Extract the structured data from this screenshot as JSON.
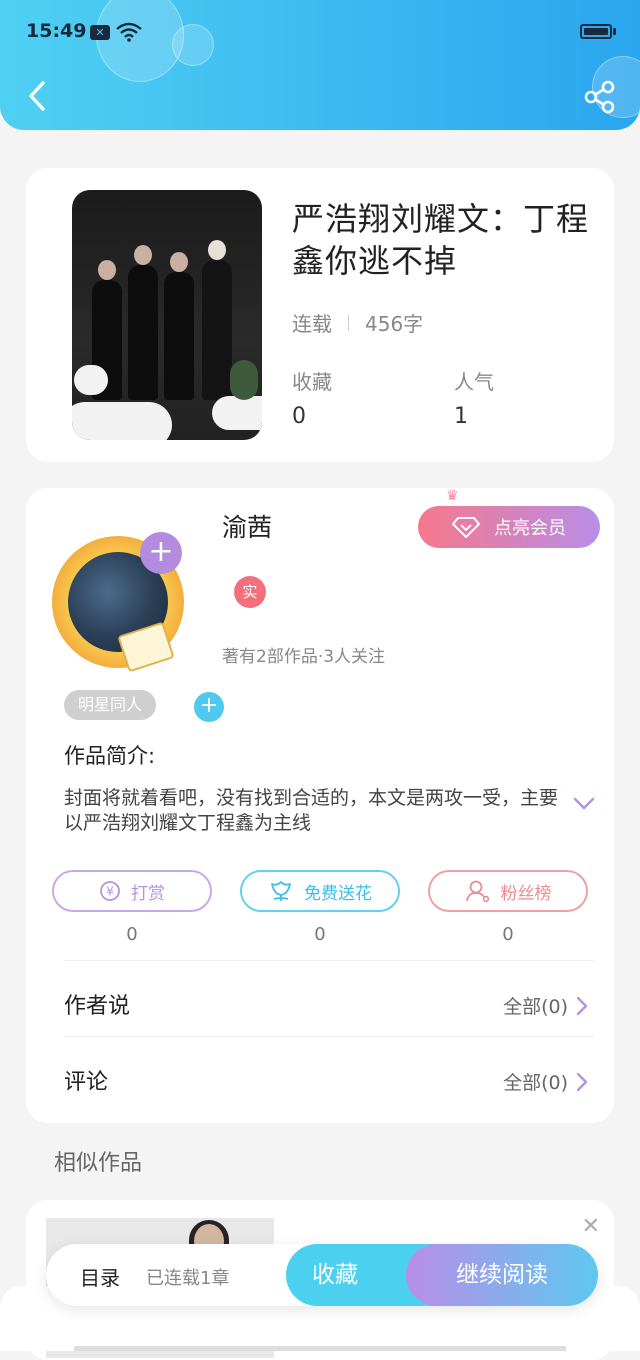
{
  "status_bar": {
    "time": "15:49"
  },
  "book": {
    "title": "严浩翔刘耀文：丁程鑫你逃不掉",
    "status": "连载",
    "word_count": "456字",
    "stats": [
      {
        "label": "收藏",
        "value": "0"
      },
      {
        "label": "人气",
        "value": "1"
      }
    ]
  },
  "author": {
    "name": "渝茜",
    "vip_button": "点亮会员",
    "real_badge": "实",
    "meta": "著有2部作品·3人关注",
    "tag": "明星同人"
  },
  "intro": {
    "label": "作品简介:",
    "text": "封面将就着看吧，没有找到合适的，本文是两攻一受，主要以严浩翔刘耀文丁程鑫为主线"
  },
  "actions": [
    {
      "label": "打赏",
      "count": "0",
      "color": "#b693e0"
    },
    {
      "label": "免费送花",
      "count": "0",
      "color": "#49c9ee"
    },
    {
      "label": "粉丝榜",
      "count": "0",
      "color": "#f08890"
    }
  ],
  "author_says": {
    "label": "作者说",
    "link": "全部(0)"
  },
  "comments": {
    "label": "评论",
    "link": "全部(0)"
  },
  "similar": {
    "title": "相似作品"
  },
  "bottom": {
    "toc": "目录",
    "chapters": "已连载1章",
    "favorite": "收藏",
    "continue": "继续阅读"
  },
  "colors": {
    "header_start": "#4fd0f2",
    "header_end": "#2aa6ef",
    "accent_purple": "#b38ce0",
    "accent_blue": "#4cd0f0"
  }
}
